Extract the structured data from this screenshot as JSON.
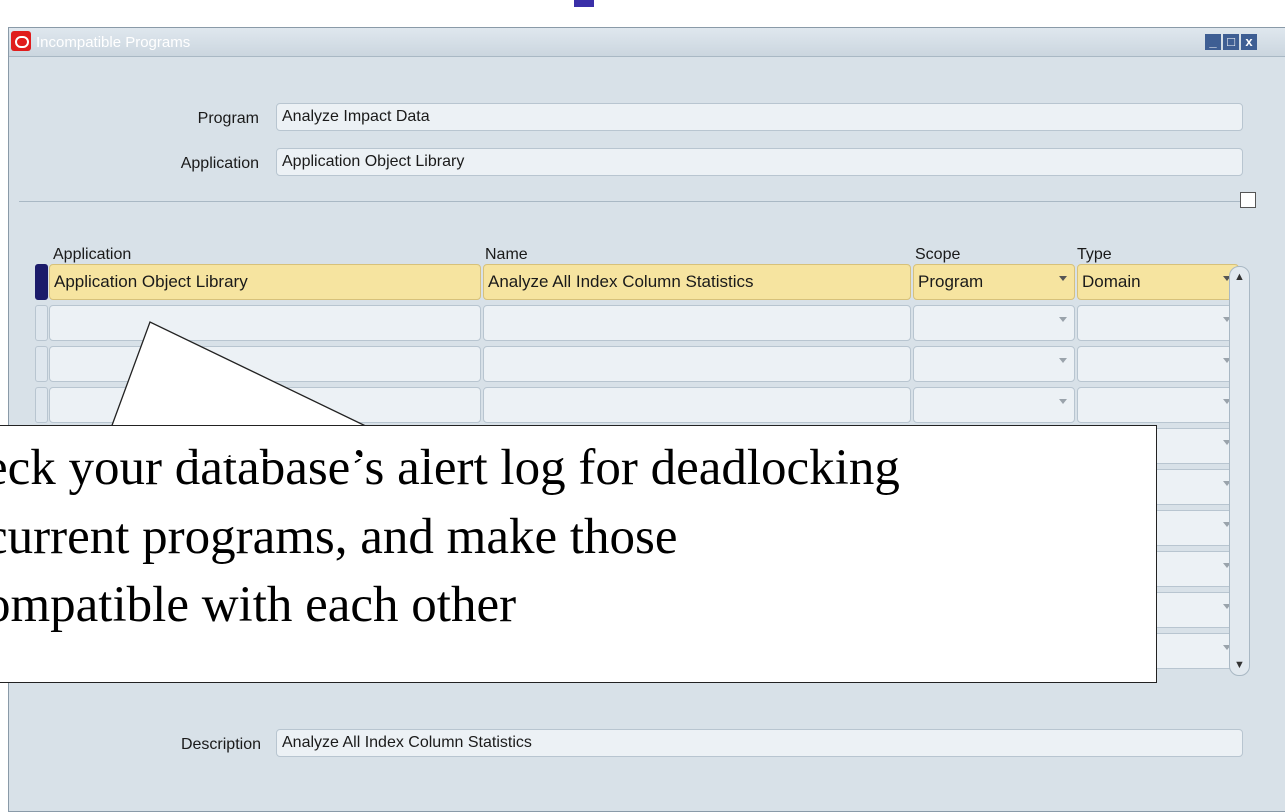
{
  "window": {
    "title": "Incompatible Programs",
    "controls": [
      "_",
      "□",
      "x"
    ]
  },
  "header": {
    "program_label": "Program",
    "program_value": "Analyze Impact Data",
    "application_label": "Application",
    "application_value": "Application Object Library"
  },
  "table": {
    "columns": [
      "Application",
      "Name",
      "Scope",
      "Type"
    ],
    "rows": [
      {
        "application": "Application Object Library",
        "name": "Analyze All Index Column Statistics",
        "scope": "Program",
        "type": "Domain"
      },
      {
        "application": "",
        "name": "",
        "scope": "",
        "type": ""
      },
      {
        "application": "",
        "name": "",
        "scope": "",
        "type": ""
      },
      {
        "application": "",
        "name": "",
        "scope": "",
        "type": ""
      },
      {
        "application": "",
        "name": "",
        "scope": "",
        "type": ""
      },
      {
        "application": "",
        "name": "",
        "scope": "",
        "type": ""
      },
      {
        "application": "",
        "name": "",
        "scope": "",
        "type": ""
      },
      {
        "application": "",
        "name": "",
        "scope": "",
        "type": ""
      },
      {
        "application": "",
        "name": "",
        "scope": "",
        "type": ""
      },
      {
        "application": "",
        "name": "",
        "scope": "",
        "type": ""
      }
    ]
  },
  "footer": {
    "description_label": "Description",
    "description_value": "Analyze All Index Column Statistics"
  },
  "callout": {
    "lines": [
      "eck your database’s alert log for deadlocking",
      "current programs, and make those",
      "ompatible with each other"
    ]
  },
  "colors": {
    "current_row": "#f6e4a0",
    "row_indicator": "#1b1b6a",
    "logo": "#e01c1c",
    "window_bg": "#d8e1e8"
  }
}
